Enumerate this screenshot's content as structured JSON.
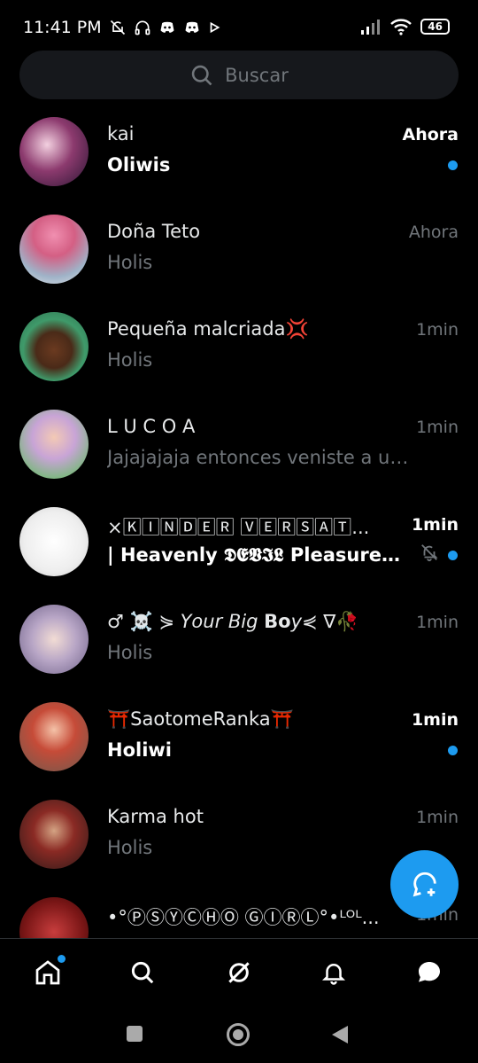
{
  "status_bar": {
    "time": "11:41 PM",
    "battery": "46"
  },
  "search": {
    "placeholder": "Buscar"
  },
  "conversations": [
    {
      "name": "kai",
      "preview": "Oliwis",
      "time": "Ahora",
      "unread": true
    },
    {
      "name": "Doña Teto",
      "preview": "Holis",
      "time": "Ahora",
      "unread": false
    },
    {
      "name": "Pequeña malcriada💢",
      "preview": "Holis",
      "time": "1min",
      "unread": false
    },
    {
      "name": "L U C O A",
      "preview": "Jajajajaja entonces veniste a un b...",
      "time": "1min",
      "unread": false
    },
    {
      "name": "×🄺🄸🄽🄳🄴🅁 🅅🄴🅁🅂🄰🅃...",
      "preview": "| Heavenly 𝕯𝕰𝖁𝕴𝕷 Pleasure🪽 |:...",
      "time": "1min",
      "unread": true,
      "muted": true
    },
    {
      "name": "♂ ☠️ ⋟ 𝘠𝘰𝘶𝘳 𝘉𝘪𝘨 𝗕𝗼𝘺⋞ ∇🥀",
      "preview": "Holis",
      "time": "1min",
      "unread": false
    },
    {
      "name": "⛩️SaotomeRanka⛩️",
      "preview": "Holiwi",
      "time": "1min",
      "unread": true
    },
    {
      "name": "Karma hot",
      "preview": "Holis",
      "time": "1min",
      "unread": false
    },
    {
      "name": "•°ⓅⓈⓎⒸⒽⓄ ⒼⒾⓇⓁ°•ᴸᴼᴸ...",
      "preview": "",
      "time": "1min",
      "unread": false
    }
  ],
  "colors": {
    "accent": "#1d9bf0",
    "muted_text": "#71767b",
    "background": "#000000"
  }
}
